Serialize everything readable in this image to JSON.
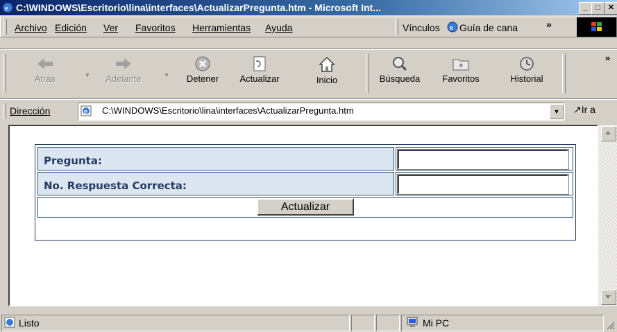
{
  "window": {
    "title": "C:\\WINDOWS\\Escritorio\\lina\\interfaces\\ActualizarPregunta.htm - Microsoft Int...",
    "controls": {
      "minimize": "_",
      "maximize": "□",
      "close": "✕"
    }
  },
  "menu": {
    "items": [
      "Archivo",
      "Edición",
      "Ver",
      "Favoritos",
      "Herramientas",
      "Ayuda"
    ],
    "links_label": "Vínculos",
    "links_item": "Guía de cana",
    "chevron": "»"
  },
  "toolbar": {
    "back": "Atrás",
    "forward": "Adelante",
    "stop": "Detener",
    "refresh": "Actualizar",
    "home": "Inicio",
    "search": "Búsqueda",
    "favorites": "Favoritos",
    "history": "Historial",
    "chevron": "»"
  },
  "address": {
    "label": "Dirección",
    "value": "C:\\WINDOWS\\Escritorio\\lina\\interfaces\\ActualizarPregunta.htm",
    "go": "Ir a"
  },
  "form": {
    "question_label": "Pregunta:",
    "question_value": "",
    "answer_label": "No. Respuesta Correcta:",
    "answer_value": "",
    "submit_label": "Actualizar"
  },
  "status": {
    "text": "Listo",
    "zone": "Mi PC"
  },
  "colors": {
    "title_gradient_start": "#0a246a",
    "title_gradient_end": "#a6caf0",
    "label_bg": "#dce6f0",
    "label_text": "#243c64",
    "table_border": "#2f4f6f"
  }
}
